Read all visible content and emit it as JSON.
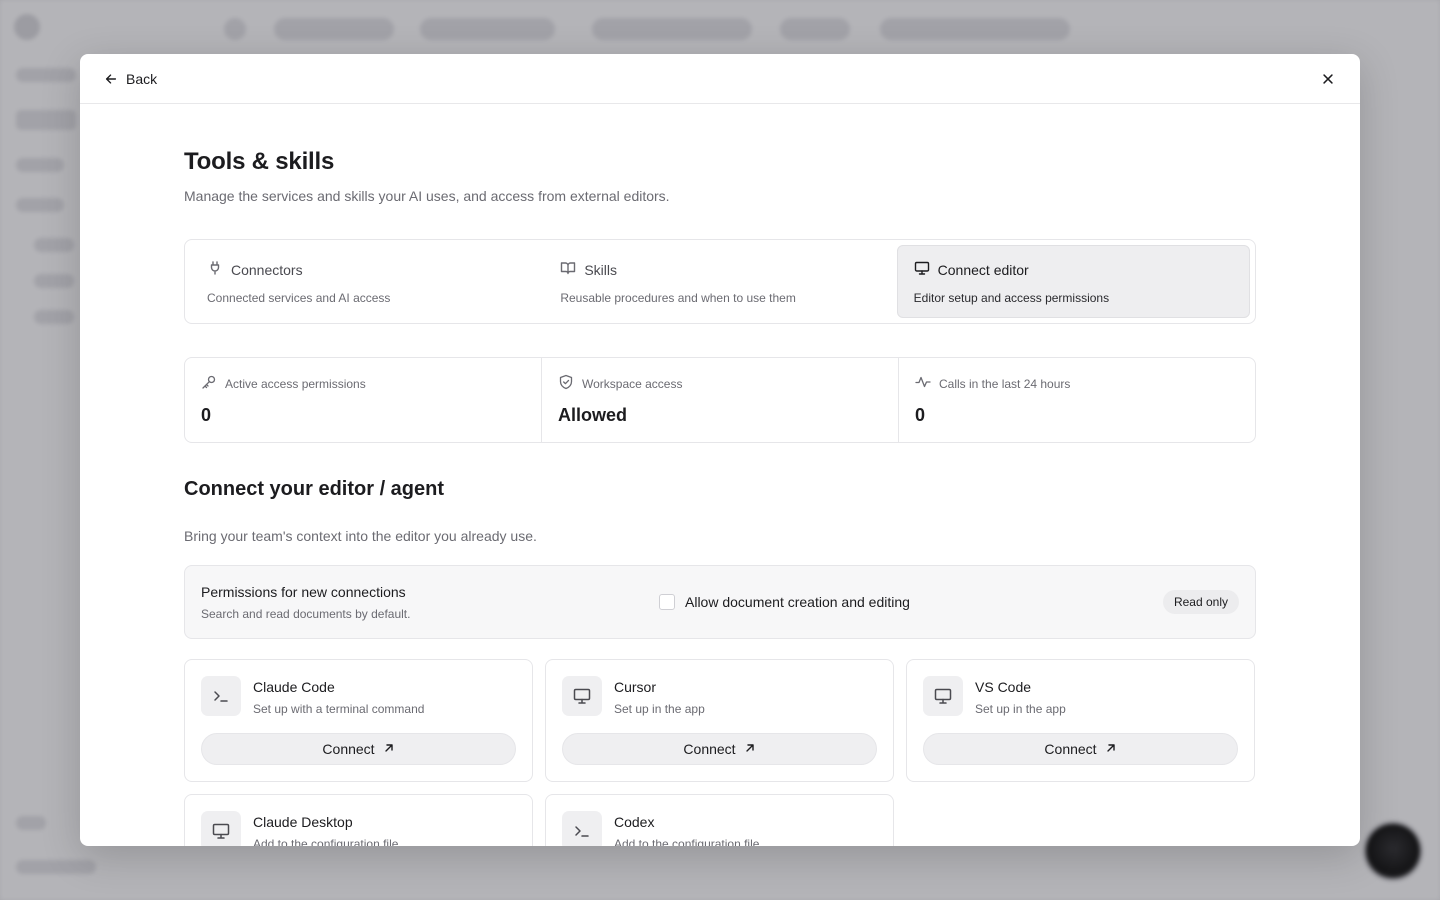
{
  "header": {
    "back_label": "Back"
  },
  "page": {
    "title": "Tools & skills",
    "subtitle": "Manage the services and skills your AI uses, and access from external editors."
  },
  "tabs": [
    {
      "label": "Connectors",
      "description": "Connected services and AI access",
      "icon": "plug-icon"
    },
    {
      "label": "Skills",
      "description": "Reusable procedures and when to use them",
      "icon": "book-icon"
    },
    {
      "label": "Connect editor",
      "description": "Editor setup and access permissions",
      "icon": "monitor-icon",
      "active": true
    }
  ],
  "stats": [
    {
      "label": "Active access permissions",
      "value": "0",
      "icon": "key-icon"
    },
    {
      "label": "Workspace access",
      "value": "Allowed",
      "icon": "shield-check-icon"
    },
    {
      "label": "Calls in the last 24 hours",
      "value": "0",
      "icon": "activity-icon"
    }
  ],
  "section": {
    "title": "Connect your editor / agent",
    "subtitle": "Bring your team's context into the editor you already use."
  },
  "permissions": {
    "title": "Permissions for new connections",
    "subtitle": "Search and read documents by default.",
    "checkbox_label": "Allow document creation and editing",
    "checked": false,
    "badge": "Read only"
  },
  "editors": [
    {
      "name": "Claude Code",
      "description": "Set up with a terminal command",
      "icon": "terminal-icon",
      "button": "Connect"
    },
    {
      "name": "Cursor",
      "description": "Set up in the app",
      "icon": "monitor-icon",
      "button": "Connect"
    },
    {
      "name": "VS Code",
      "description": "Set up in the app",
      "icon": "monitor-icon",
      "button": "Connect"
    },
    {
      "name": "Claude Desktop",
      "description": "Add to the configuration file",
      "icon": "monitor-icon"
    },
    {
      "name": "Codex",
      "description": "Add to the configuration file",
      "icon": "terminal-icon"
    }
  ]
}
